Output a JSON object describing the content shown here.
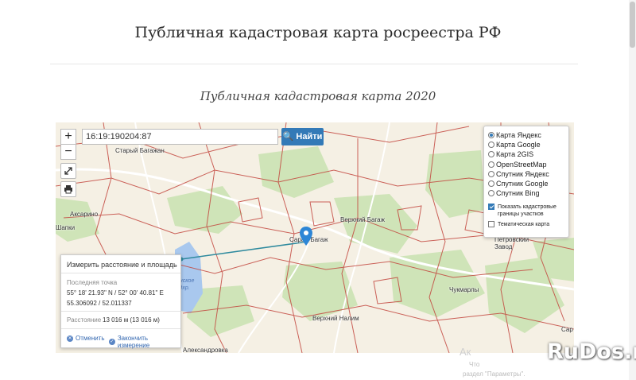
{
  "header": {
    "title": "Публичная кадастровая карта росреестра РФ",
    "subtitle": "Публичная кадастровая карта 2020"
  },
  "map": {
    "zoom_in": "+",
    "zoom_out": "−",
    "search_value": "16:19:190204:87",
    "search_button": "Найти",
    "layers": [
      {
        "label": "Карта Яндекс",
        "selected": true
      },
      {
        "label": "Карта Google",
        "selected": false
      },
      {
        "label": "Карта 2GIS",
        "selected": false
      },
      {
        "label": "OpenStreetMap",
        "selected": false
      },
      {
        "label": "Спутник Яндекс",
        "selected": false
      },
      {
        "label": "Спутник Google",
        "selected": false
      },
      {
        "label": "Спутник Bing",
        "selected": false
      }
    ],
    "show_boundaries_label": "Показать кадастровые границы участков",
    "show_boundaries_checked": true,
    "thematic_label": "Тематическая карта",
    "thematic_checked": false,
    "places": {
      "stary_bagazh": "Старый Багажан",
      "aksarino": "Аксарино",
      "shapki": "Шапки",
      "saray_bagazh": "Сарай-Багаж",
      "verkhny_bagazh": "Верхний Багаж",
      "petrovsky_zavod": "Петровский Завод",
      "chukmarly": "Чукмарлы",
      "verkhny_nalim": "Верхний Налим",
      "aleksandrovka": "Александровка",
      "sar": "Сар"
    },
    "lake_label": "инское\nвдхр."
  },
  "measure": {
    "title": "Измерить расстояние и площадь",
    "last_point_label": "Последняя точка",
    "coords_dms": "55° 18' 21.93\" N / 52° 00' 40.81\" E",
    "coords_dec": "55.306092 / 52.011337",
    "distance_label": "Расстояние",
    "distance_value": "13 016 м (13 016 м)",
    "cancel": "Отменить",
    "finish": "Закончить измерение"
  },
  "watermark": {
    "line1": "Ак",
    "line2": "Что",
    "line3": "раздел \"Параметры\".",
    "site": "RuDos.ru"
  }
}
